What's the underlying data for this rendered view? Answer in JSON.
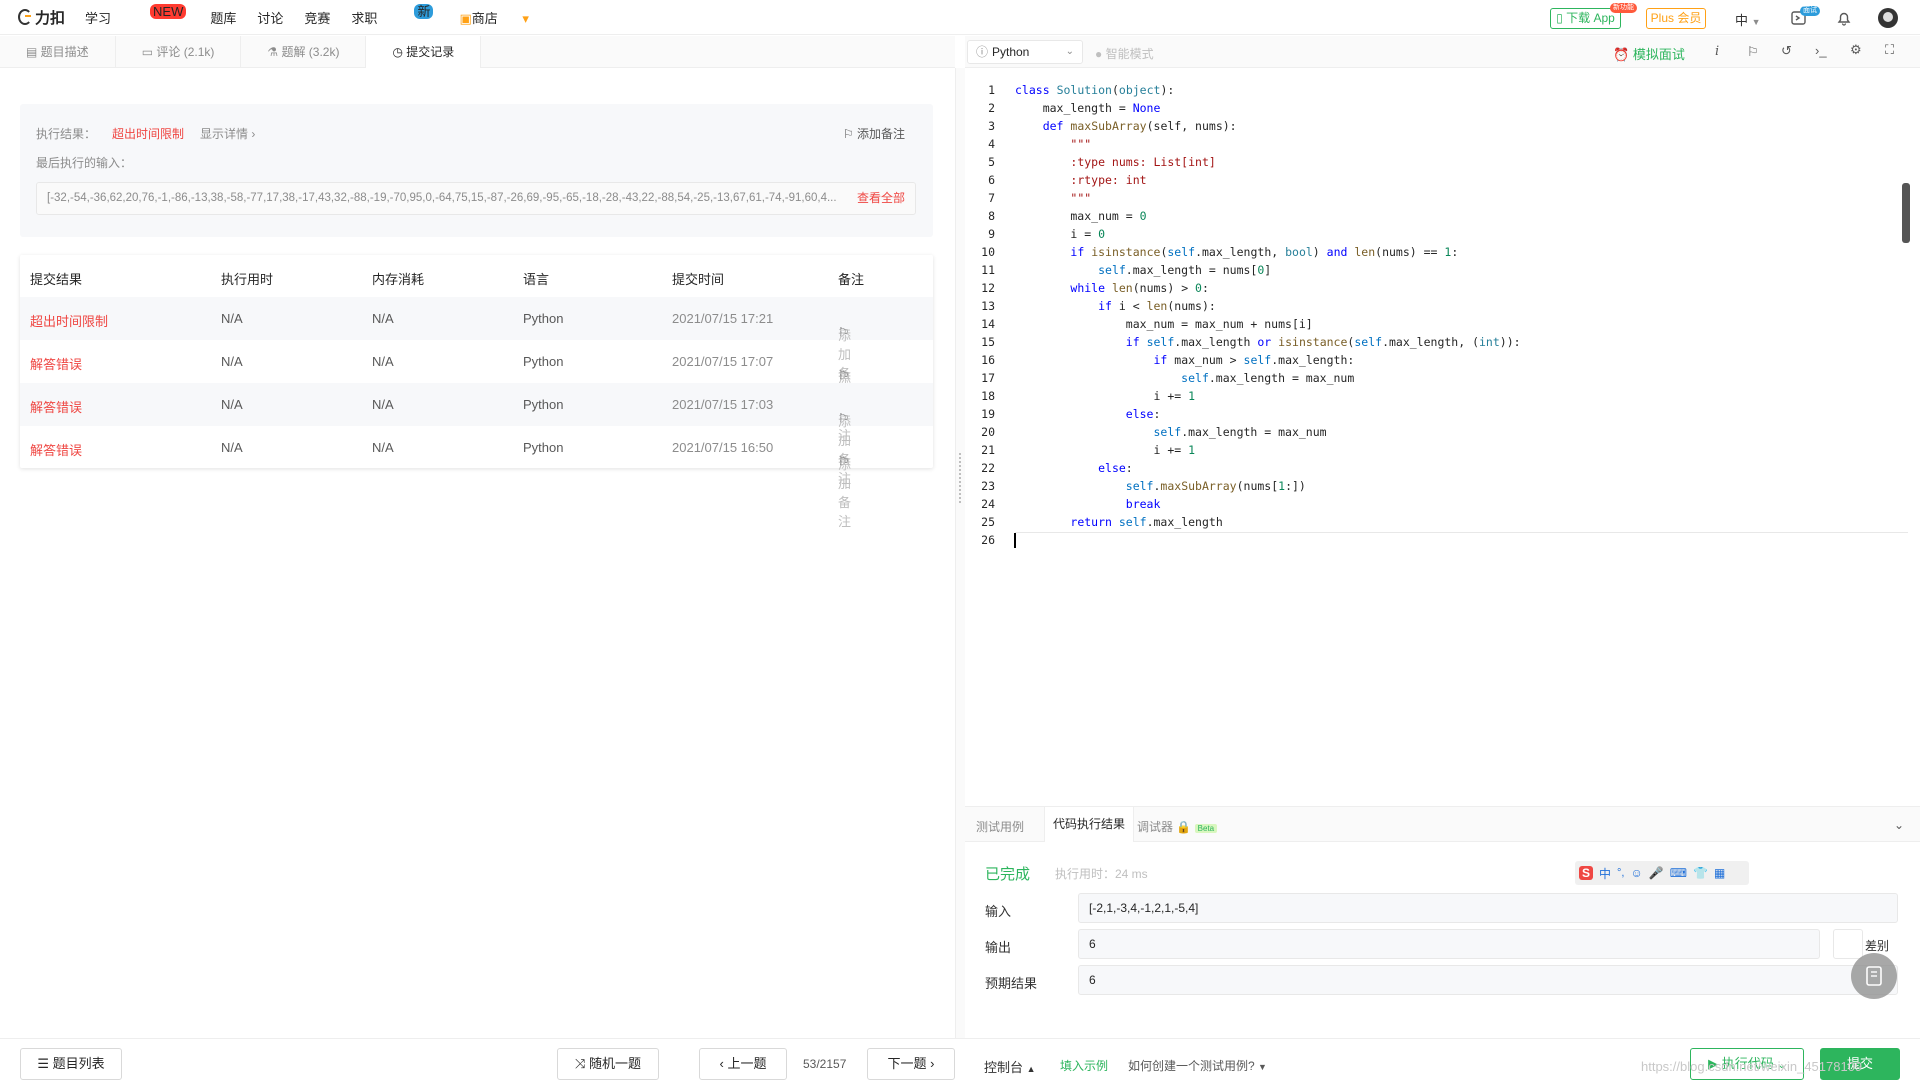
{
  "nav": {
    "logo": "力扣",
    "links": [
      "学习",
      "题库",
      "讨论",
      "竞赛",
      "求职"
    ],
    "shop": "商店",
    "badge_new": "NEW",
    "badge_job": "新",
    "download_app": "下载 App",
    "download_badge": "新功能",
    "plus": "Plus 会员",
    "language": "中",
    "notif_badge": "面试"
  },
  "left_tabs": [
    {
      "label": "题目描述"
    },
    {
      "label": "评论 (2.1k)"
    },
    {
      "label": "题解 (3.2k)"
    },
    {
      "label": "提交记录"
    }
  ],
  "result": {
    "label": "执行结果：",
    "status": "超出时间限制",
    "detail": "显示详情",
    "add_note": "添加备注",
    "last_input_label": "最后执行的输入：",
    "last_input": "[-32,-54,-36,62,20,76,-1,-86,-13,38,-58,-77,17,38,-17,43,32,-88,-19,-70,95,0,-64,75,15,-87,-26,69,-95,-65,-18,-28,-43,22,-88,54,-25,-13,67,61,-74,-91,60,4...",
    "view_all": "查看全部"
  },
  "table": {
    "headers": [
      "提交结果",
      "执行用时",
      "内存消耗",
      "语言",
      "提交时间",
      "备注"
    ],
    "rows": [
      {
        "result": "超出时间限制",
        "time": "N/A",
        "memory": "N/A",
        "lang": "Python",
        "submitted": "2021/07/15 17:21",
        "note": "添加备注"
      },
      {
        "result": "解答错误",
        "time": "N/A",
        "memory": "N/A",
        "lang": "Python",
        "submitted": "2021/07/15 17:07",
        "note": "添加备注"
      },
      {
        "result": "解答错误",
        "time": "N/A",
        "memory": "N/A",
        "lang": "Python",
        "submitted": "2021/07/15 17:03",
        "note": "添加备注"
      },
      {
        "result": "解答错误",
        "time": "N/A",
        "memory": "N/A",
        "lang": "Python",
        "submitted": "2021/07/15 16:50",
        "note": "添加备注"
      }
    ]
  },
  "editor": {
    "language": "Python",
    "smart_mode": "智能模式",
    "mock_interview": "模拟面试",
    "line_numbers": [
      "1",
      "2",
      "3",
      "4",
      "5",
      "6",
      "7",
      "8",
      "9",
      "10",
      "11",
      "12",
      "13",
      "14",
      "15",
      "16",
      "17",
      "18",
      "19",
      "20",
      "21",
      "22",
      "23",
      "24",
      "25",
      "26"
    ]
  },
  "console": {
    "tabs": [
      "测试用例",
      "代码执行结果",
      "调试器"
    ],
    "beta": "Beta",
    "status": "已完成",
    "runtime": "执行用时：24 ms",
    "input_label": "输入",
    "input_value": "[-2,1,-3,4,-1,2,1,-5,4]",
    "output_label": "输出",
    "output_value": "6",
    "diff_label": "差别",
    "expected_label": "预期结果",
    "expected_value": "6"
  },
  "bottom": {
    "problem_list": "题目列表",
    "random": "随机一题",
    "prev": "上一题",
    "page": "53/2157",
    "next": "下一题",
    "console": "控制台",
    "fill_example": "填入示例",
    "how_create": "如何创建一个测试用例?",
    "run_code": "执行代码",
    "submit": "提交",
    "watermark": "https://blog.csdn.net/weixin_45178109"
  },
  "colors": {
    "accent_orange": "#ffa116",
    "green": "#2db55d",
    "red": "#ef4743"
  }
}
